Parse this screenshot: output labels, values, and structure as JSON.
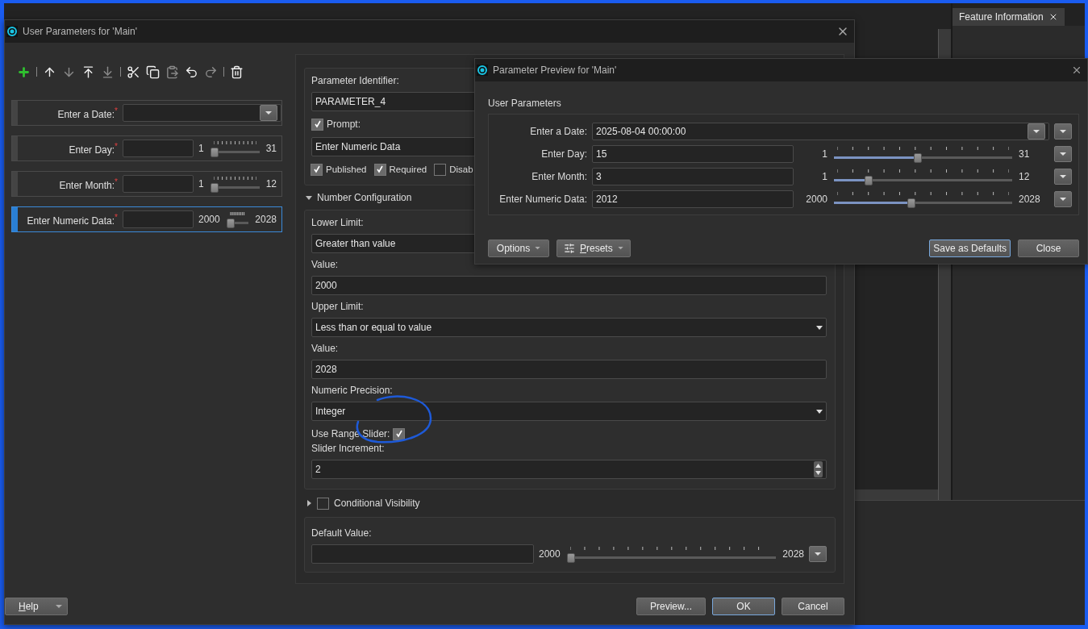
{
  "background_app": {
    "panel_tab": {
      "label": "Feature Information",
      "selected": true
    }
  },
  "main_dialog": {
    "title": "User Parameters for 'Main'",
    "toolbar": [
      {
        "kind": "add",
        "disabled": false
      },
      {
        "kind": "separator"
      },
      {
        "kind": "up",
        "disabled": false
      },
      {
        "kind": "down",
        "disabled": true
      },
      {
        "kind": "top",
        "disabled": false
      },
      {
        "kind": "bottom",
        "disabled": true
      },
      {
        "kind": "separator"
      },
      {
        "kind": "cut",
        "disabled": false
      },
      {
        "kind": "copy",
        "disabled": false
      },
      {
        "kind": "paste",
        "disabled": true
      },
      {
        "kind": "undo",
        "disabled": false
      },
      {
        "kind": "redo",
        "disabled": true
      },
      {
        "kind": "separator"
      },
      {
        "kind": "delete",
        "disabled": false
      }
    ],
    "parameters": [
      {
        "kind": "date",
        "label": "Enter a Date:$^{*}$",
        "selected": false
      },
      {
        "kind": "slider",
        "label": "Enter Day:$^{*}$",
        "min": "1",
        "max": "31",
        "level": 0,
        "selected": false
      },
      {
        "kind": "slider",
        "label": "Enter Month:$^{*}$",
        "min": "1",
        "max": "12",
        "level": 0,
        "selected": false
      },
      {
        "kind": "slider",
        "label": "Enter Numeric Data:$^{*}$",
        "min": "2000",
        "max": "2028",
        "level": 0,
        "selected": true
      }
    ],
    "identifier": {
      "label": "Parameter Identifier:",
      "value": "PARAMETER_4"
    },
    "prompt": {
      "label": "Prompt:",
      "checked": true,
      "value": "Enter Numeric Data"
    },
    "flags": [
      {
        "label": "Published",
        "checked": true
      },
      {
        "label": "Required",
        "checked": true
      },
      {
        "label": "Disab",
        "checked": false
      }
    ],
    "number_configuration": {
      "title": "Number Configuration",
      "expanded": true,
      "fields": [
        {
          "kind": "dropdown",
          "label": "Lower Limit:",
          "value": "Greater than value"
        },
        {
          "kind": "text",
          "label": "Value:",
          "value": "2000"
        },
        {
          "kind": "dropdown",
          "label": "Upper Limit:",
          "value": "Less than or equal to value"
        },
        {
          "kind": "text",
          "label": "Value:",
          "value": "2028"
        },
        {
          "kind": "dropdown",
          "label": "Numeric Precision:",
          "value": "Integer"
        },
        {
          "kind": "checkbox",
          "label": "Use Range Slider:",
          "checked": true
        },
        {
          "kind": "spin",
          "label": "Slider Increment:",
          "value": "2"
        }
      ]
    },
    "conditional_visibility": {
      "label": "Conditional Visibility",
      "checked": false,
      "expanded": false
    },
    "default_value": {
      "label": "Default Value:",
      "min": "2000",
      "max": "2028",
      "level": 0
    },
    "help_button": {
      "label": "Help"
    },
    "buttons": [
      {
        "label": "Preview...",
        "default": false
      },
      {
        "label": "OK",
        "default": true
      },
      {
        "label": "Cancel",
        "default": false
      }
    ]
  },
  "preview_dialog": {
    "title": "Parameter Preview for 'Main'",
    "group_title": "User Parameters",
    "rows": [
      {
        "kind": "date",
        "label": "Enter a Date:",
        "value": "2025-08-04 00:00:00"
      },
      {
        "kind": "slider",
        "label": "Enter Day:",
        "value": "15",
        "min": "1",
        "max": "31",
        "level": 0.467
      },
      {
        "kind": "slider",
        "label": "Enter Month:",
        "value": "3",
        "min": "1",
        "max": "12",
        "level": 0.182
      },
      {
        "kind": "slider",
        "label": "Enter Numeric Data:",
        "value": "2012",
        "min": "2000",
        "max": "2028",
        "level": 0.429
      }
    ],
    "left_buttons": [
      {
        "kind": "options",
        "label": "Options"
      },
      {
        "kind": "presets",
        "label": "Presets"
      }
    ],
    "right_buttons": [
      {
        "label": "Save as Defaults",
        "default": true
      },
      {
        "label": "Close",
        "default": false
      }
    ]
  }
}
